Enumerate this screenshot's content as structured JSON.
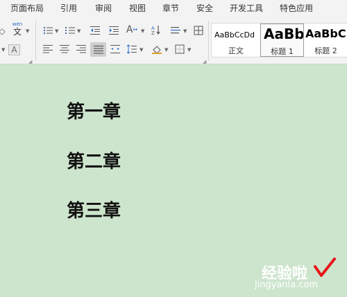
{
  "menu": {
    "items": [
      "页面布局",
      "引用",
      "审阅",
      "视图",
      "章节",
      "安全",
      "开发工具",
      "特色应用"
    ]
  },
  "ribbon": {
    "font_glyph": "A",
    "phonetic_glyph": "wén",
    "phonetic_char": "文",
    "styles": [
      {
        "sample": "AaBbCcDd",
        "name": "正文"
      },
      {
        "sample": "AaBb",
        "name": "标题 1"
      },
      {
        "sample": "AaBbC",
        "name": "标题 2"
      }
    ]
  },
  "document": {
    "headings": [
      "第一章",
      "第二章",
      "第三章"
    ]
  },
  "watermark": {
    "text": "经验啦",
    "url": "jingyanla.com"
  },
  "colors": {
    "page_background": "#cde5cd",
    "ribbon_background": "#f3f3f3",
    "watermark_check": "#e8141c"
  }
}
